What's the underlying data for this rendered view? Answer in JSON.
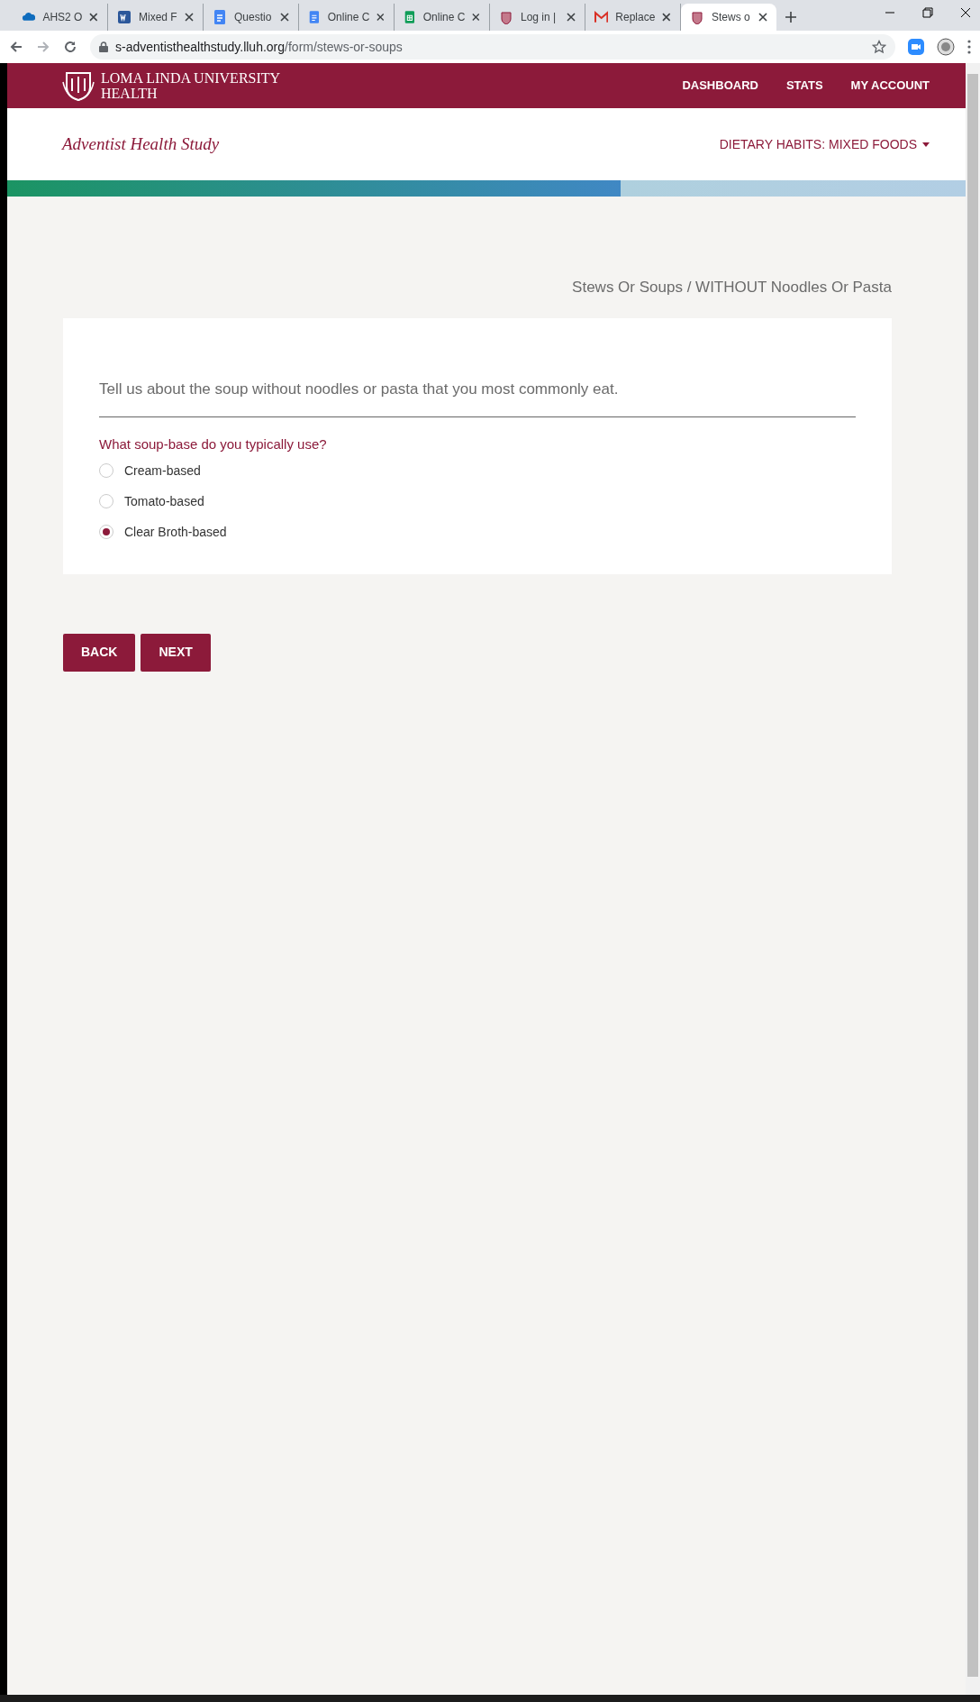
{
  "browser": {
    "tabs": [
      {
        "title": "AHS2 O",
        "kind": "cloud",
        "selected": false
      },
      {
        "title": "Mixed F",
        "kind": "word",
        "selected": false
      },
      {
        "title": "Questio",
        "kind": "doc",
        "selected": false
      },
      {
        "title": "Online C",
        "kind": "doc",
        "selected": false
      },
      {
        "title": "Online C",
        "kind": "sheet",
        "selected": false
      },
      {
        "title": "Log in |",
        "kind": "crest",
        "selected": false
      },
      {
        "title": "Replace",
        "kind": "mail",
        "selected": false
      },
      {
        "title": "Stews o",
        "kind": "crest",
        "selected": true
      }
    ],
    "url_host": "s-adventisthealthstudy.lluh.org",
    "url_path": "/form/stews-or-soups"
  },
  "header": {
    "logo_lines": [
      "LOMA LINDA UNIVERSITY",
      "HEALTH"
    ],
    "nav": [
      "DASHBOARD",
      "STATS",
      "MY ACCOUNT"
    ]
  },
  "subheader": {
    "study_title": "Adventist Health Study",
    "section_menu": "DIETARY HABITS: MIXED FOODS"
  },
  "progress": {
    "level": 0.64
  },
  "breadcrumb": "Stews Or Soups / WITHOUT Noodles Or Pasta",
  "card": {
    "intro": "Tell us about the soup without noodles or pasta that you most commonly eat.",
    "question": "What soup-base do you typically use?",
    "options": [
      {
        "label": "Cream-based",
        "selected": false
      },
      {
        "label": "Tomato-based",
        "selected": false
      },
      {
        "label": "Clear Broth-based",
        "selected": true
      }
    ]
  },
  "buttons": [
    "BACK",
    "NEXT"
  ]
}
